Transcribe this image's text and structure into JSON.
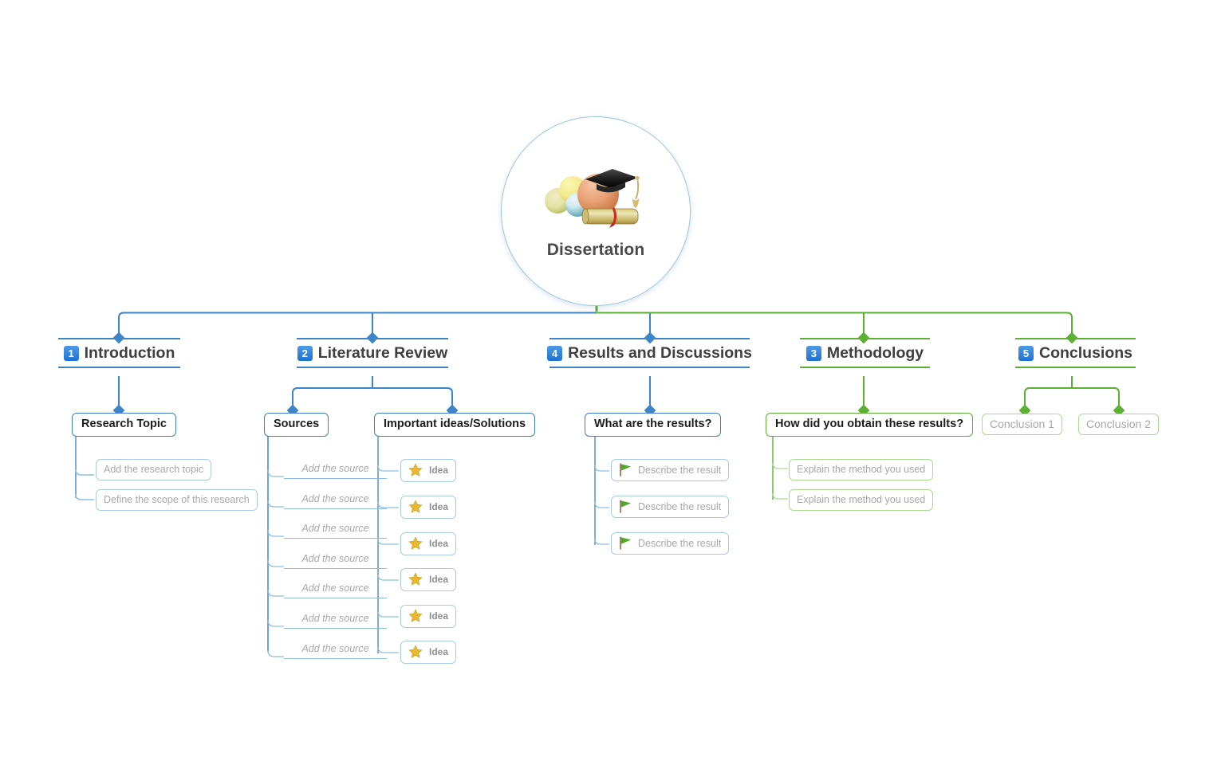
{
  "root": {
    "label": "Dissertation",
    "icon": "graduation-cap-diploma-icon"
  },
  "colors": {
    "blue": "#3d85c8",
    "green": "#5cb135",
    "leaf_blue_border": "#a8cbe8",
    "leaf_green_border": "#a9dc92",
    "placeholder_text": "#a8a8a8",
    "badge_blue": "#1d72d0",
    "star_gold": "#e8b830",
    "flag_green": "#4eaa2a"
  },
  "branches": [
    {
      "number": "1",
      "label": "Introduction",
      "color": "blue",
      "children": [
        {
          "label": "Research Topic",
          "color": "blue",
          "children": [
            {
              "label": "Add the research topic",
              "style": "box",
              "color": "blue"
            },
            {
              "label": "Define the scope of this research",
              "style": "box",
              "color": "blue"
            }
          ]
        }
      ]
    },
    {
      "number": "2",
      "label": "Literature Review",
      "color": "blue",
      "children": [
        {
          "label": "Sources",
          "color": "blue",
          "children": [
            {
              "label": "Add the source",
              "style": "underline",
              "color": "blue"
            },
            {
              "label": "Add the source",
              "style": "underline",
              "color": "blue"
            },
            {
              "label": "Add the source",
              "style": "underline",
              "color": "blue"
            },
            {
              "label": "Add the source",
              "style": "underline",
              "color": "blue"
            },
            {
              "label": "Add the source",
              "style": "underline",
              "color": "blue"
            },
            {
              "label": "Add the source",
              "style": "underline",
              "color": "blue"
            },
            {
              "label": "Add the source",
              "style": "underline",
              "color": "blue"
            }
          ]
        },
        {
          "label": "Important ideas/Solutions",
          "color": "blue",
          "children": [
            {
              "label": "Idea",
              "style": "box",
              "color": "blue",
              "icon": "star-icon"
            },
            {
              "label": "Idea",
              "style": "box",
              "color": "blue",
              "icon": "star-icon"
            },
            {
              "label": "Idea",
              "style": "box",
              "color": "blue",
              "icon": "star-icon"
            },
            {
              "label": "Idea",
              "style": "box",
              "color": "blue",
              "icon": "star-icon"
            },
            {
              "label": "Idea",
              "style": "box",
              "color": "blue",
              "icon": "star-icon"
            },
            {
              "label": "Idea",
              "style": "box",
              "color": "blue",
              "icon": "star-icon"
            }
          ]
        }
      ]
    },
    {
      "number": "4",
      "label": "Results and Discussions",
      "color": "blue",
      "children": [
        {
          "label": "What are the results?",
          "color": "blue",
          "children": [
            {
              "label": "Describe the result",
              "style": "box",
              "color": "blue",
              "icon": "flag-icon"
            },
            {
              "label": "Describe the result",
              "style": "box",
              "color": "blue",
              "icon": "flag-icon"
            },
            {
              "label": "Describe the result",
              "style": "box",
              "color": "blue",
              "icon": "flag-icon"
            }
          ]
        }
      ]
    },
    {
      "number": "3",
      "label": "Methodology",
      "color": "green",
      "children": [
        {
          "label": "How did you obtain these results?",
          "color": "green",
          "children": [
            {
              "label": "Explain the method you used",
              "style": "box",
              "color": "green"
            },
            {
              "label": "Explain the method you used",
              "style": "box",
              "color": "green"
            }
          ]
        }
      ]
    },
    {
      "number": "5",
      "label": "Conclusions",
      "color": "green",
      "children": [
        {
          "label": "Conclusion 1",
          "color": "green",
          "placeholder": true,
          "children": []
        },
        {
          "label": "Conclusion 2",
          "color": "green",
          "placeholder": true,
          "children": []
        }
      ]
    }
  ]
}
